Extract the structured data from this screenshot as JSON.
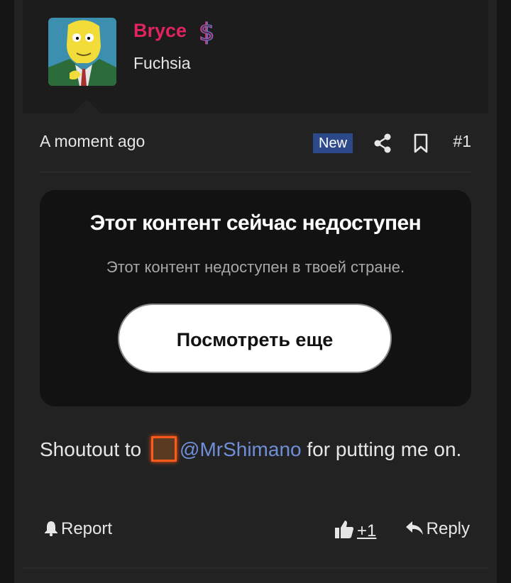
{
  "user": {
    "name": "Bryce",
    "title": "Fuchsia",
    "avatar_icon": "burns-avatar",
    "name_color": "#e0245e"
  },
  "meta": {
    "timestamp": "A moment ago",
    "badge": "New",
    "post_number": "#1"
  },
  "embed": {
    "title": "Этот контент сейчас недоступен",
    "subtitle": "Этот контент недоступен в твоей стране.",
    "button": "Посмотреть еще"
  },
  "message": {
    "prefix": "Shoutout to ",
    "mention": "@MrShimano",
    "suffix": " for putting me on."
  },
  "actions": {
    "report": "Report",
    "like_count": "+1",
    "reply": "Reply"
  },
  "colors": {
    "mention": "#6f8fd8",
    "badge_bg": "#2c4a8a",
    "accent": "#e0245e"
  }
}
